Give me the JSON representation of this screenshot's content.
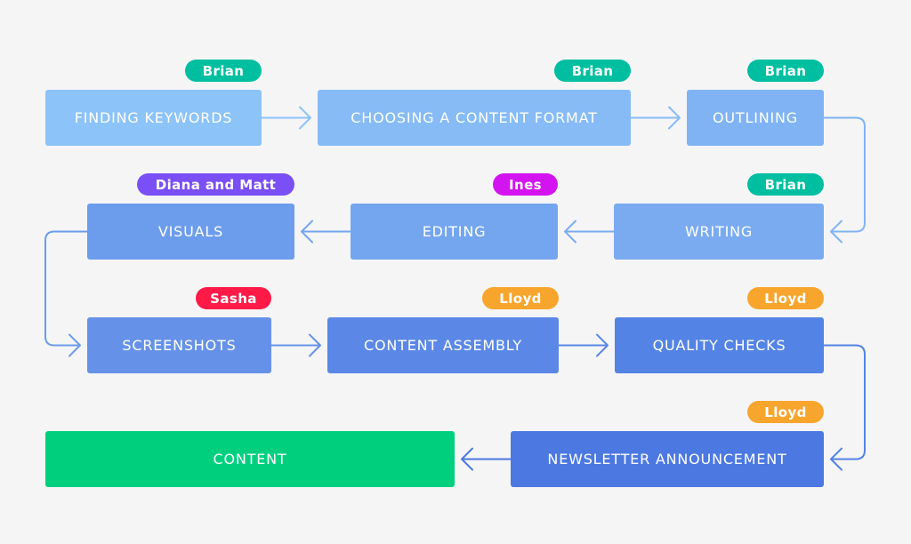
{
  "colors": {
    "background": "#f5f5f6",
    "step_shades": [
      "#8cc3f8",
      "#86bbf6",
      "#80b3f4",
      "#7aabf1",
      "#74a5ef",
      "#6c9cec",
      "#6592e8",
      "#5b88e6",
      "#5383e4",
      "#4c78e1"
    ],
    "final": "#00d07e",
    "people": {
      "Brian": "#00bfa0",
      "Diana and Matt": "#7a4ff5",
      "Ines": "#d414f0",
      "Sasha": "#ff1a48",
      "Lloyd": "#f8a52d"
    }
  },
  "steps": [
    {
      "id": "finding-keywords",
      "label": "Finding Keywords",
      "owner": "Brian"
    },
    {
      "id": "choosing-a-content-format",
      "label": "Choosing a Content Format",
      "owner": "Brian"
    },
    {
      "id": "outlining",
      "label": "Outlining",
      "owner": "Brian"
    },
    {
      "id": "writing",
      "label": "Writing",
      "owner": "Brian"
    },
    {
      "id": "editing",
      "label": "Editing",
      "owner": "Ines"
    },
    {
      "id": "visuals",
      "label": "Visuals",
      "owner": "Diana and Matt"
    },
    {
      "id": "screenshots",
      "label": "Screenshots",
      "owner": "Sasha"
    },
    {
      "id": "content-assembly",
      "label": "Content Assembly",
      "owner": "Lloyd"
    },
    {
      "id": "quality-checks",
      "label": "Quality Checks",
      "owner": "Lloyd"
    },
    {
      "id": "newsletter-announcement",
      "label": "Newsletter Announcement",
      "owner": "Lloyd"
    },
    {
      "id": "content",
      "label": "Content",
      "owner": null
    }
  ]
}
